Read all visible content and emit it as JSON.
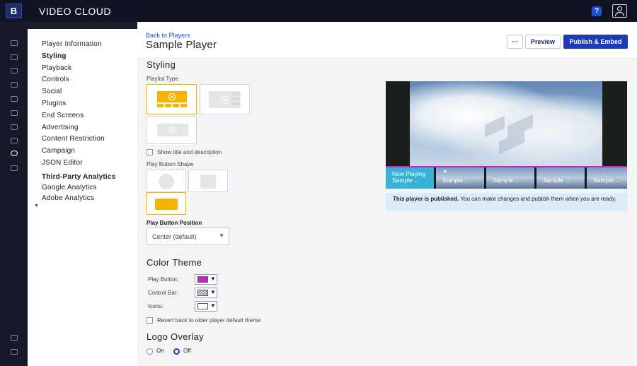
{
  "app": {
    "brand": "VIDEO CLOUD",
    "logo_letter": "B",
    "help_label": "?"
  },
  "nav": {
    "items": [
      {
        "label": "Player Information",
        "bold": false
      },
      {
        "label": "Styling",
        "bold": true
      },
      {
        "label": "Playback",
        "bold": false
      },
      {
        "label": "Controls",
        "bold": false
      },
      {
        "label": "Social",
        "bold": false
      },
      {
        "label": "Plugins",
        "bold": false
      },
      {
        "label": "End Screens",
        "bold": false
      },
      {
        "label": "Advertising",
        "bold": false
      },
      {
        "label": "Content Restriction",
        "bold": false
      },
      {
        "label": "Campaign",
        "bold": false
      },
      {
        "label": "JSON Editor",
        "bold": false
      }
    ],
    "analytics": {
      "group_label": "Third-Party Analytics",
      "items": [
        "Google Analytics",
        "Adobe Analytics"
      ]
    }
  },
  "header": {
    "back_link": "Back to Players",
    "title": "Sample Player",
    "more_label": "···",
    "preview_label": "Preview",
    "publish_label": "Publish & Embed"
  },
  "styling": {
    "section_title": "Styling",
    "playlist_type_label": "Playlist Type",
    "show_title_label": "Show title and description",
    "play_button_shape_label": "Play Button Shape",
    "play_button_position_label": "Play Button Position",
    "play_button_position_value": "Center (default)"
  },
  "color_theme": {
    "title": "Color Theme",
    "rows": [
      {
        "label": "Play Button:",
        "color": "#d01fd0"
      },
      {
        "label": "Control Bar:",
        "color": "#b8b8b8"
      },
      {
        "label": "Icons:",
        "color": "#ffffff"
      }
    ],
    "revert_label": "Revert back to older player default theme"
  },
  "logo_overlay": {
    "title": "Logo Overlay",
    "options": [
      {
        "label": "On",
        "selected": false
      },
      {
        "label": "Off",
        "selected": true
      }
    ]
  },
  "preview": {
    "thumbnails": [
      "Now Playing Sample ...",
      "Sample ...",
      "Sample ...",
      "Sample ...",
      "Sample ..."
    ],
    "notice_bold": "This player is published.",
    "notice_text": " You can make changes and publish them when you are ready."
  },
  "colors": {
    "accent": "#1d3ab8",
    "selected_option": "#f5b400",
    "play_button": "#d01fd0"
  }
}
